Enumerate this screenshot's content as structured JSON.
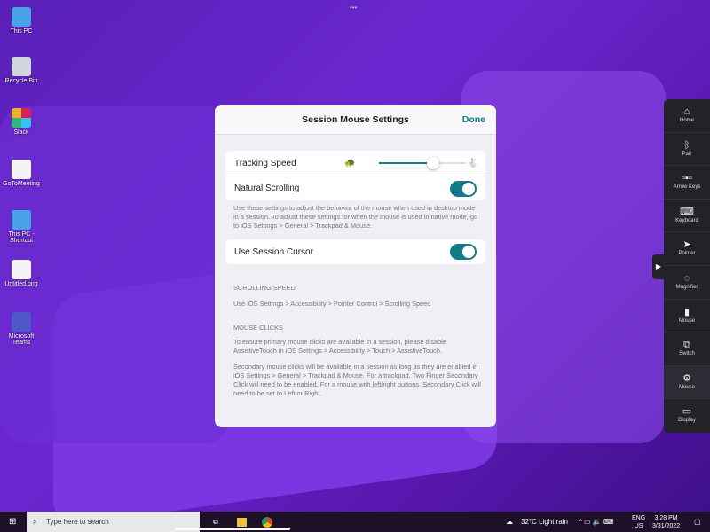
{
  "desktop": {
    "icons": [
      "This PC",
      "Recycle Bin",
      "Slack",
      "GoToMeeting",
      "This PC - Shortcut",
      "Untitled.png",
      "Microsoft Teams"
    ]
  },
  "dialog": {
    "title": "Session Mouse Settings",
    "done": "Done",
    "tracking_speed": "Tracking Speed",
    "tracking_speed_value": 0.62,
    "natural_scrolling": "Natural Scrolling",
    "natural_scrolling_on": true,
    "note": "Use these settings to adjust the behavior of the mouse when used in desktop mode in a session. To adjust these settings for when the mouse is used in native mode, go to iOS Settings > General > Trackpad & Mouse.",
    "use_session_cursor": "Use Session Cursor",
    "use_session_cursor_on": true,
    "scrolling_speed_header": "SCROLLING SPEED",
    "scrolling_speed_text": "Use iOS Settings > Accessibility > Pointer Control > Scrolling Speed",
    "mouse_clicks_header": "MOUSE CLICKS",
    "mouse_clicks_text1": "To ensure primary mouse clicks are available in a session, please disable AssistiveTouch in iOS Settings > Accessibility > Touch > AssistiveTouch.",
    "mouse_clicks_text2": "Secondary mouse clicks will be available in a session as long as they are enabled in iOS Settings > General > Trackpad & Mouse. For a trackpad, Two Finger Secondary Click will need to be enabled. For a mouse with left/right buttons, Secondary Click will need to be set to Left or Right."
  },
  "sidebar": {
    "items": [
      "Home",
      "Pair",
      "Arrow Keys",
      "Keyboard",
      "Pointer",
      "Magnifier",
      "Mouse",
      "Switch",
      "Mouse",
      "Display"
    ]
  },
  "taskbar": {
    "search_placeholder": "Type here to search",
    "weather": "32°C  Light rain",
    "lang": "ENG",
    "region": "US",
    "time": "3:28 PM",
    "date": "3/31/2022"
  },
  "colors": {
    "accent": "#137a8a"
  }
}
